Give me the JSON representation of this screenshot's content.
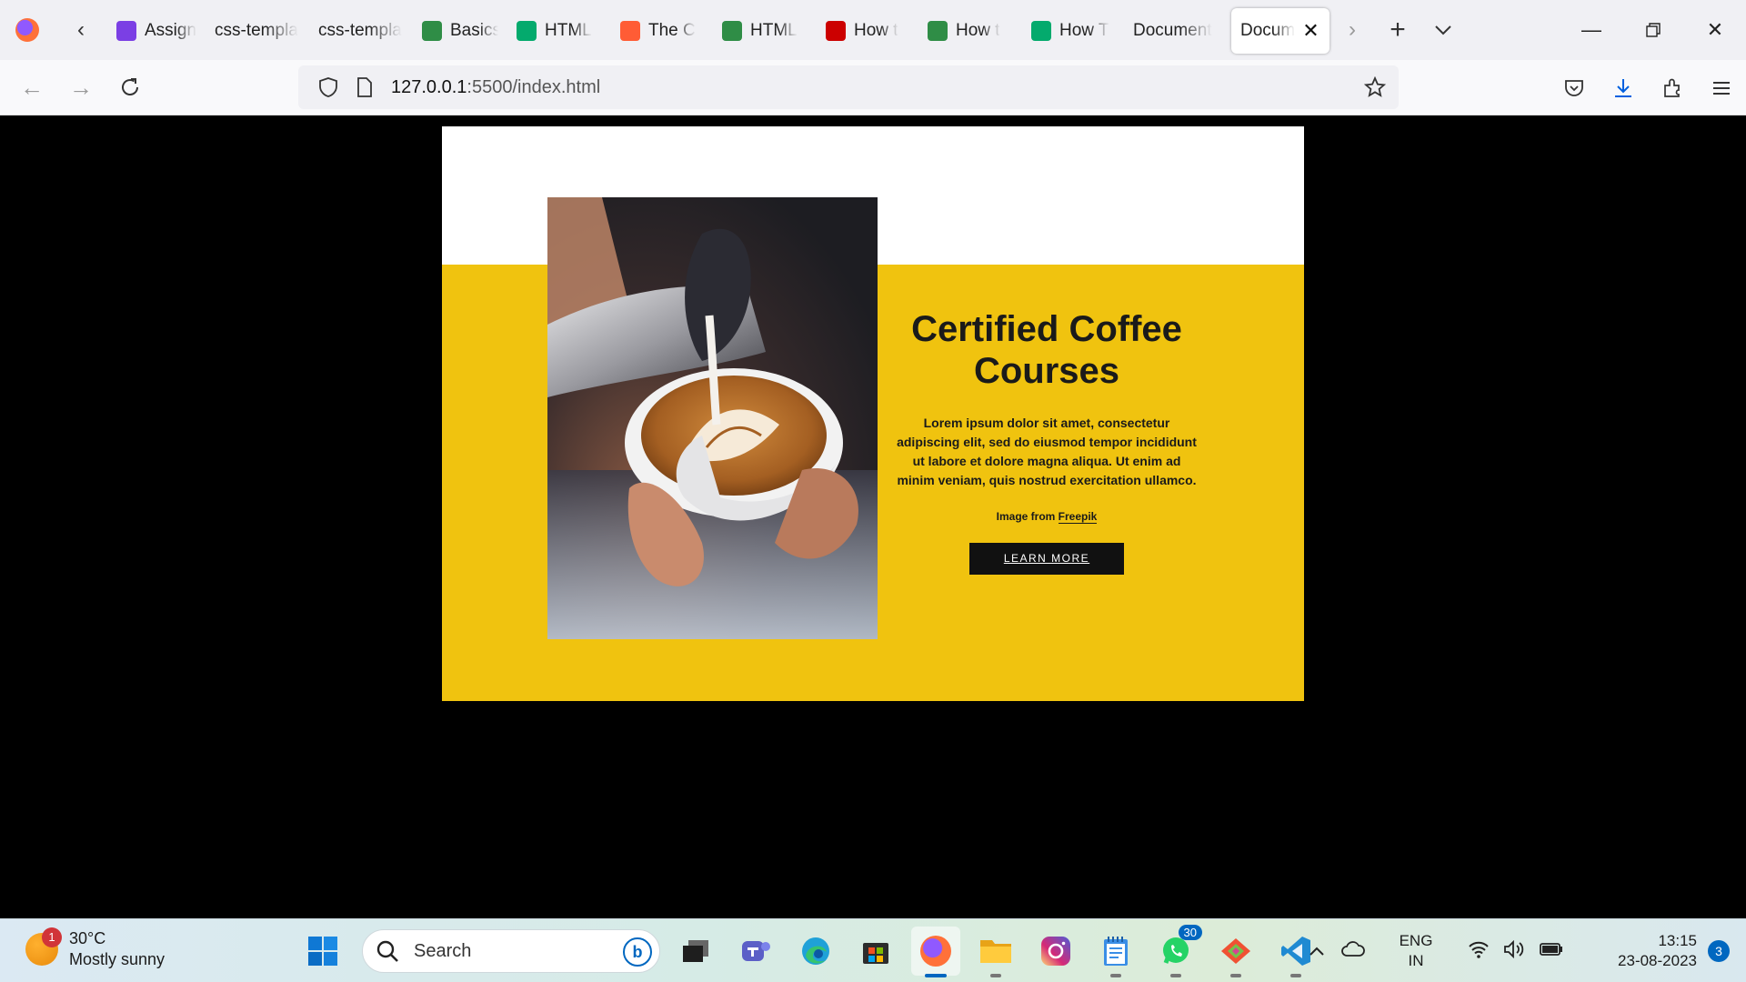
{
  "browser": {
    "tabs": [
      {
        "label": "Assign",
        "icon": "assignment-favicon-icon",
        "color": "#7b3fe4"
      },
      {
        "label": "css-templa",
        "icon": "",
        "color": ""
      },
      {
        "label": "css-templa",
        "icon": "",
        "color": ""
      },
      {
        "label": "Basics",
        "icon": "geeksforgeeks-favicon-icon",
        "color": "#2f8d46"
      },
      {
        "label": "HTML",
        "icon": "w3schools-favicon-icon",
        "color": "#04aa6d"
      },
      {
        "label": "The C",
        "icon": "hubspot-favicon-icon",
        "color": "#ff5c35"
      },
      {
        "label": "HTML",
        "icon": "geeksforgeeks-favicon-icon",
        "color": "#2f8d46"
      },
      {
        "label": "How t",
        "icon": "youtube-favicon-icon",
        "color": "#cc0000"
      },
      {
        "label": "How t",
        "icon": "geeksforgeeks-favicon-icon",
        "color": "#2f8d46"
      },
      {
        "label": "How T",
        "icon": "w3schools-favicon-icon",
        "color": "#04aa6d"
      },
      {
        "label": "Document",
        "icon": "",
        "color": ""
      },
      {
        "label": "Docum",
        "icon": "",
        "color": "",
        "active": true
      }
    ],
    "url_host": "127.0.0.1",
    "url_path": ":5500/index.html"
  },
  "page": {
    "title": "Certified Coffee Courses",
    "description": "Lorem ipsum dolor sit amet, consectetur adipiscing elit, sed do eiusmod tempor incididunt ut labore et dolore magna aliqua. Ut enim ad minim veniam, quis nostrud exercitation ullamco.",
    "credit_prefix": "Image from ",
    "credit_link": "Freepik",
    "button": "LEARN MORE",
    "accent_color": "#f0c30f"
  },
  "taskbar": {
    "weather_badge": "1",
    "temperature": "30°C",
    "condition": "Mostly sunny",
    "search_placeholder": "Search",
    "whatsapp_count": "30",
    "lang_1": "ENG",
    "lang_2": "IN",
    "time": "13:15",
    "date": "23-08-2023",
    "notifications": "3"
  }
}
